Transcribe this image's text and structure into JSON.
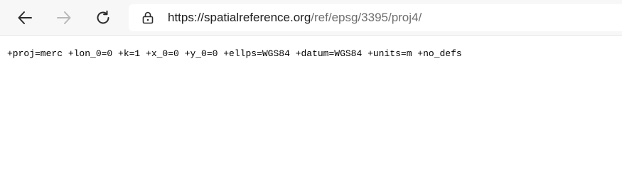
{
  "browser": {
    "back_icon": "arrow-left-icon",
    "forward_icon": "arrow-right-icon",
    "refresh_icon": "refresh-icon",
    "lock_icon": "lock-icon",
    "url_host": "https://spatialreference.org",
    "url_path": "/ref/epsg/3395/proj4/",
    "colors": {
      "toolbar_bg": "#f7f7f7",
      "icon_active": "#2b2b2b",
      "icon_disabled": "#b8b8b8",
      "url_host": "#202020",
      "url_path": "#6e6e6e"
    }
  },
  "page": {
    "text": "+proj=merc +lon_0=0 +k=1 +x_0=0 +y_0=0 +ellps=WGS84 +datum=WGS84 +units=m +no_defs"
  }
}
